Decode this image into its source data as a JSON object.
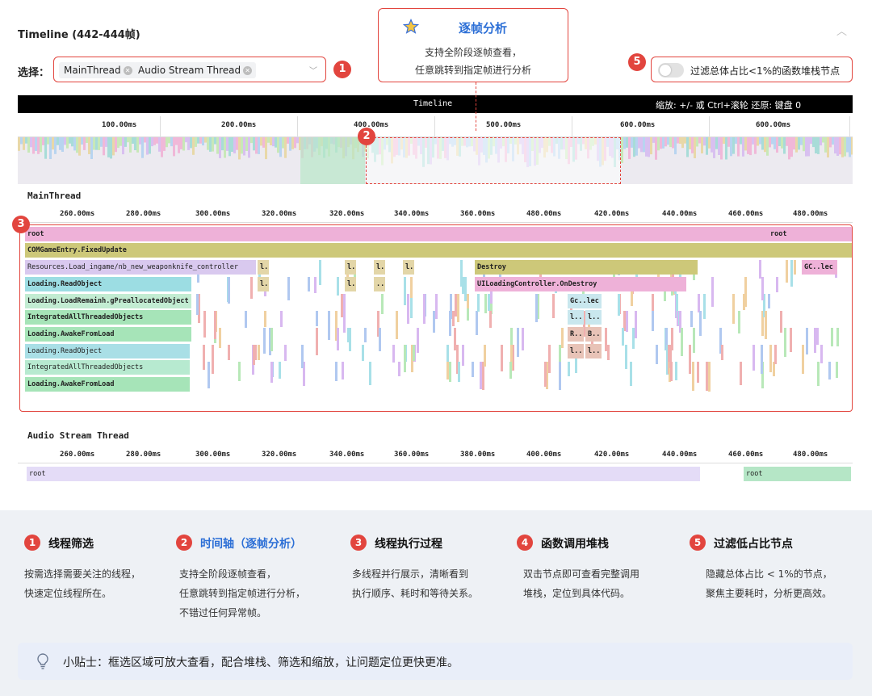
{
  "panel": {
    "title": "Timeline (442-444帧)"
  },
  "select": {
    "label": "选择：",
    "chips": [
      "MainThread",
      "Audio Stream Thread"
    ]
  },
  "callout": {
    "title": "逐帧分析",
    "line1": "支持全阶段逐帧查看，",
    "line2": "任意跳转到指定帧进行分析"
  },
  "filter": {
    "label": "过滤总体占比<1%的函数堆栈节点",
    "enabled": false
  },
  "badges": [
    "1",
    "2",
    "3",
    "5"
  ],
  "timeline_bar": {
    "title": "Timeline",
    "hint": "缩放: +/- 或 Ctrl+滚轮  还原: 键盘 0"
  },
  "overview_ticks": [
    "100.00ms",
    "200.00ms",
    "400.00ms",
    "500.00ms",
    "600.00ms",
    "600.00ms"
  ],
  "main_thread": {
    "name": "MainThread",
    "ticks": [
      "260.00ms",
      "280.00ms",
      "300.00ms",
      "320.00ms",
      "320.00ms",
      "340.00ms",
      "360.00ms",
      "480.00ms",
      "420.00ms",
      "440.00ms",
      "460.00ms",
      "480.00ms"
    ],
    "frames": {
      "root": "root",
      "root2": "root",
      "fixed": "COMGameEntry.FixedUpdate",
      "res": "Resources.Load_ingame/nb_new_weaponknife_controller",
      "destroy": "Destroy",
      "gc": "GC..lec",
      "readobj": "Loading.ReadObject",
      "uiload": "UILoadingController.OnDestroy",
      "loadrem": "Loading.LoadRemainh.gPreallocatedObject",
      "integ": "IntegratedAllThreadedObjects",
      "awake": "Loading.AwakeFromLoad",
      "readobj2": "Loading.ReadObject",
      "integ2": "IntegratedAllThreadedObjects",
      "awake2": "Loading.AwakeFromLoad",
      "s1": "l..",
      "s2": "l..",
      "s3": "l..",
      "s4": "l..",
      "s5": "l..",
      "s6": "l..",
      "s7": "..",
      "gc2": "Gc..lec",
      "k1": "l..",
      "k2": "l..",
      "r1": "R..",
      "b1": "B..",
      "k3": "l..",
      "k4": "l.."
    }
  },
  "audio_thread": {
    "name": "Audio Stream Thread",
    "ticks": [
      "260.00ms",
      "280.00ms",
      "300.00ms",
      "320.00ms",
      "340.00ms",
      "360.00ms",
      "380.00ms",
      "400.00ms",
      "420.00ms",
      "440.00ms",
      "460.00ms",
      "480.00ms"
    ],
    "root": "root",
    "root2": "root"
  },
  "legend": [
    {
      "num": "1",
      "title": "线程筛选",
      "l1": "按需选择需要关注的线程，",
      "l2": "快速定位线程所在。",
      "l3": "",
      "color": "#111111"
    },
    {
      "num": "2",
      "title": "时间轴（逐帧分析）",
      "l1": "支持全阶段逐帧查看，",
      "l2": "任意跳转到指定帧进行分析，",
      "l3": "不错过任何异常帧。",
      "color": "#2c6fd6"
    },
    {
      "num": "3",
      "title": "线程执行过程",
      "l1": "多线程并行展示，清晰看到",
      "l2": "执行顺序、耗时和等待关系。",
      "l3": "",
      "color": "#111111"
    },
    {
      "num": "4",
      "title": "函数调用堆栈",
      "l1": "双击节点即可查看完整调用",
      "l2": "堆栈，定位到具体代码。",
      "l3": "",
      "color": "#111111"
    },
    {
      "num": "5",
      "title": "过滤低占比节点",
      "l1": "隐藏总体占比 < 1%的节点，",
      "l2": "聚焦主要耗时，分析更高效。",
      "l3": "",
      "color": "#111111"
    }
  ],
  "tip": {
    "text": "小贴士：框选区域可放大查看，配合堆栈、筛选和缩放，让问题定位更快更准。"
  }
}
